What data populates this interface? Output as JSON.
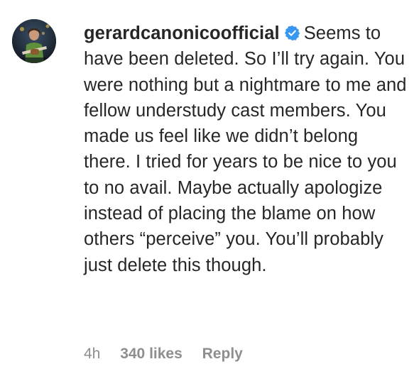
{
  "comment": {
    "username": "gerardcanonicoofficial",
    "verified": true,
    "text": "Seems to have been deleted. So I’ll try again. You were nothing but a nightmare to me and fellow understudy cast members. You made us feel like we didn’t belong there. I tried for years to be nice to you to no avail. Maybe actually apologize instead of placing the blame on how others “perceive” you. You’ll probably just delete this though.",
    "time": "4h",
    "likes": "340 likes",
    "reply_label": "Reply"
  },
  "colors": {
    "text": "#262626",
    "meta": "#8e8e8e",
    "verified_badge": "#3897f0"
  },
  "icons": {
    "verified": "verified-badge-icon",
    "avatar": "profile-photo"
  }
}
